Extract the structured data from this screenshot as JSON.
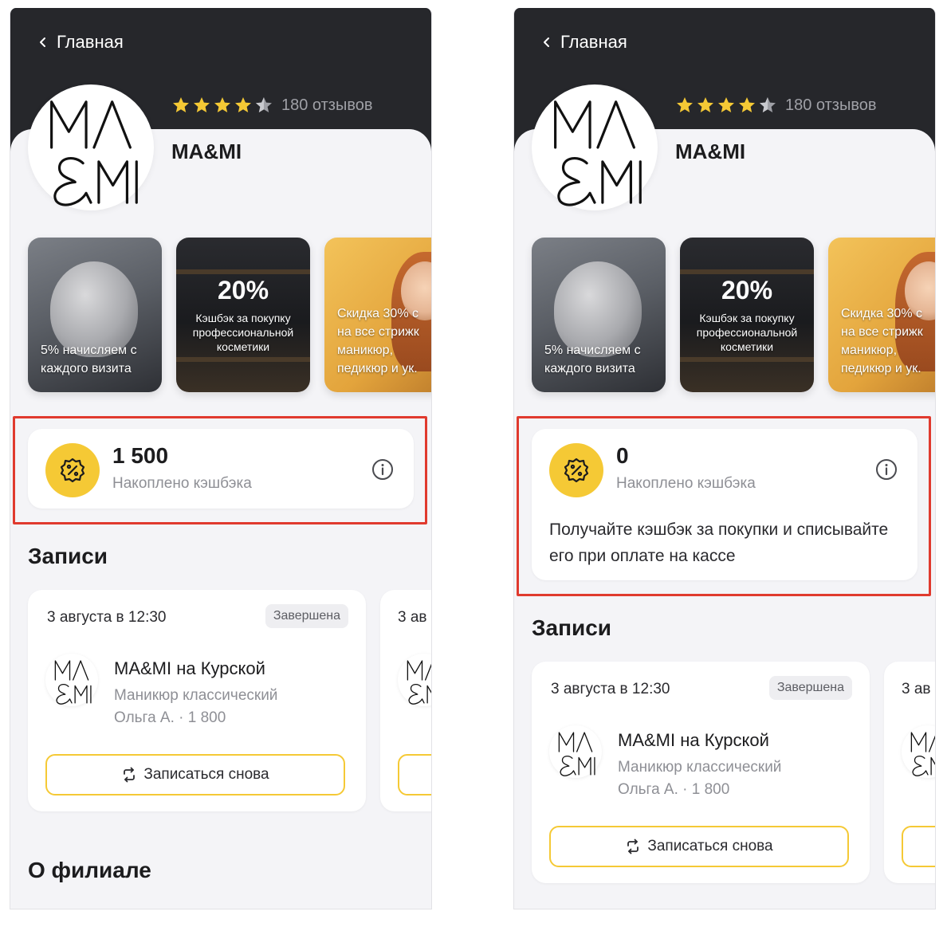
{
  "screens": [
    {
      "header": {
        "back_label": "Главная"
      },
      "salon": {
        "name": "MA&MI",
        "rating": 4.5,
        "reviews": "180 отзывов"
      },
      "promos": [
        {
          "text_line1": "5% начисляем с",
          "text_line2": "каждого визита"
        },
        {
          "big": "20%",
          "small": "Кэшбэк за покупку профессиональной косметики"
        },
        {
          "text_line1": "Скидка 30% с",
          "text_line2": "на все стрижк",
          "text_line3": "маникюр,",
          "text_line4": "педикюр и ук."
        }
      ],
      "cashback": {
        "value": "1 500",
        "label": "Накоплено кэшбэка"
      },
      "sections": {
        "bookings": "Записи",
        "about": "О филиале"
      },
      "booking": {
        "date": "3 августа в 12:30",
        "status": "Завершена",
        "salon_name": "MA&MI на Курской",
        "service": "Маникюр классический",
        "meta": "Ольга А. · 1 800",
        "rebook": "Записаться снова"
      },
      "booking_peek": {
        "date": "3 ав"
      }
    },
    {
      "header": {
        "back_label": "Главная"
      },
      "salon": {
        "name": "MA&MI",
        "rating": 4.5,
        "reviews": "180 отзывов"
      },
      "promos": [
        {
          "text_line1": "5% начисляем с",
          "text_line2": "каждого визита"
        },
        {
          "big": "20%",
          "small": "Кэшбэк за покупку профессиональной косметики"
        },
        {
          "text_line1": "Скидка 30% с",
          "text_line2": "на все стрижк",
          "text_line3": "маникюр,",
          "text_line4": "педикюр и ук."
        }
      ],
      "cashback": {
        "value": "0",
        "label": "Накоплено кэшбэка",
        "description": "Получайте кэшбэк за покупки и списывайте его при оплате на кассе"
      },
      "sections": {
        "bookings": "Записи"
      },
      "booking": {
        "date": "3 августа в 12:30",
        "status": "Завершена",
        "salon_name": "MA&MI на Курской",
        "service": "Маникюр классический",
        "meta": "Ольга А. · 1 800",
        "rebook": "Записаться снова"
      },
      "booking_peek": {
        "date": "3 ав"
      }
    }
  ],
  "colors": {
    "header_bg": "#26272b",
    "accent_yellow": "#f5c935",
    "highlight_red": "#e03a2e",
    "page_bg": "#f4f4f7"
  },
  "icons": [
    "chevron-left-icon",
    "star-icon",
    "cashback-percent-icon",
    "info-icon",
    "refresh-icon"
  ]
}
